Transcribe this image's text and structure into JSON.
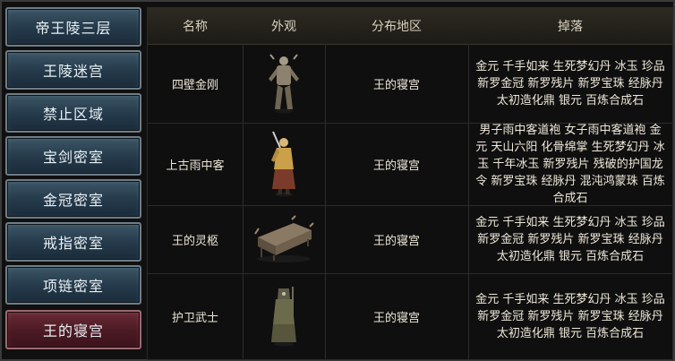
{
  "sidebar": {
    "items": [
      {
        "label": "帝王陵三层"
      },
      {
        "label": "王陵迷宫"
      },
      {
        "label": "禁止区域"
      },
      {
        "label": "宝剑密室"
      },
      {
        "label": "金冠密室"
      },
      {
        "label": "戒指密室"
      },
      {
        "label": "项链密室"
      },
      {
        "label": "王的寝宫",
        "active": true
      }
    ]
  },
  "table": {
    "headers": {
      "name": "名称",
      "appearance": "外观",
      "region": "分布地区",
      "drops": "掉落"
    },
    "rows": [
      {
        "name": "四壁金刚",
        "appearance_icon": "armored-demon-figure-icon",
        "region": "王的寝宫",
        "drops": "金元 千手如来 生死梦幻丹 冰玉 珍品新罗金冠 新罗残片 新罗宝珠 经脉丹 太初造化鼎 银元 百炼合成石"
      },
      {
        "name": "上古雨中客",
        "appearance_icon": "robed-swordsman-figure-icon",
        "region": "王的寝宫",
        "drops": "男子雨中客道袍 女子雨中客道袍 金元 天山六阳 化骨绵掌 生死梦幻丹 冰玉 千年冰玉 新罗残片 残破的护国龙令 新罗宝珠 经脉丹 混沌鸿蒙珠 百炼合成石"
      },
      {
        "name": "王的灵柩",
        "appearance_icon": "coffin-icon",
        "region": "王的寝宫",
        "drops": "金元 千手如来 生死梦幻丹 冰玉 珍品新罗金冠 新罗残片 新罗宝珠 经脉丹 太初造化鼎 银元 百炼合成石"
      },
      {
        "name": "护卫武士",
        "appearance_icon": "hooded-guard-figure-icon",
        "region": "王的寝宫",
        "drops": "金元 千手如来 生死梦幻丹 冰玉 珍品新罗金冠 新罗残片 新罗宝珠 经脉丹 太初造化鼎 银元 百炼合成石"
      }
    ]
  }
}
